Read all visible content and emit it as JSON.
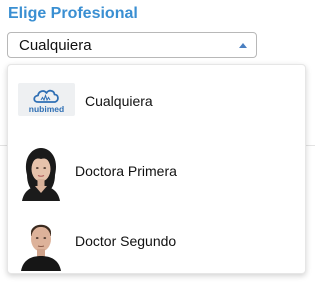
{
  "form": {
    "title": "Elige Profesional",
    "selected_value": "Cualquiera"
  },
  "dropdown": {
    "options": [
      {
        "label": "Cualquiera",
        "icon": "nubimed-logo",
        "logo_text": "nubimed"
      },
      {
        "label": "Doctora Primera",
        "icon": "female-avatar"
      },
      {
        "label": "Doctor Segundo",
        "icon": "male-avatar"
      }
    ]
  },
  "colors": {
    "title": "#3a8fd2",
    "logo_blue": "#2f6fb4"
  }
}
